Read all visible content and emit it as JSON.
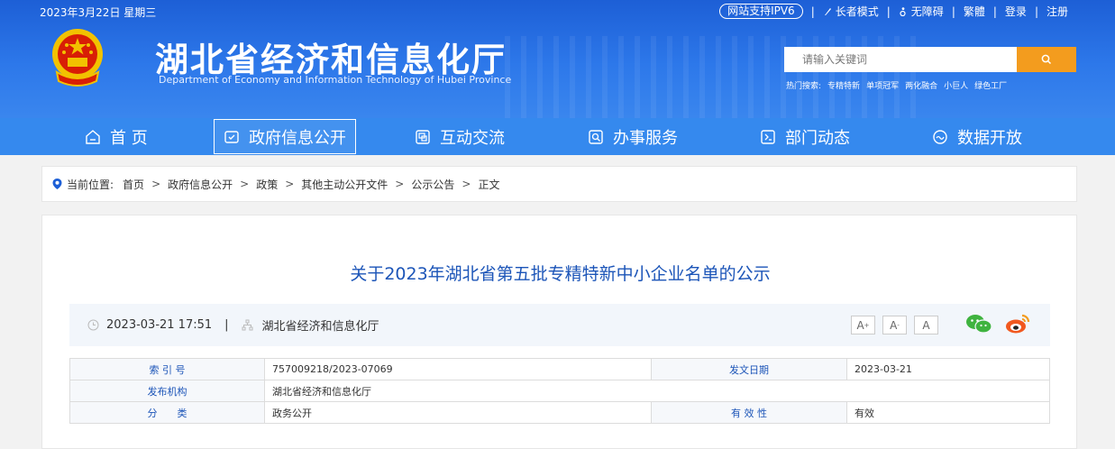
{
  "topbar": {
    "date": "2023年3月22日 星期三",
    "ipv6": "网站支持IPV6",
    "elder_mode": "长者模式",
    "accessibility": "无障碍",
    "traditional": "繁體",
    "login": "登录",
    "register": "注册",
    "separator": "|"
  },
  "header": {
    "title": "湖北省经济和信息化厅",
    "subtitle": "Department of Economy and Information Technology of Hubei Province"
  },
  "search": {
    "placeholder": "请输入关键词",
    "hot_label": "热门搜索:",
    "hot_terms": [
      "专精特新",
      "单项冠军",
      "两化融合",
      "小巨人",
      "绿色工厂"
    ]
  },
  "nav": {
    "items": [
      {
        "label": "首 页",
        "icon": "home-icon"
      },
      {
        "label": "政府信息公开",
        "icon": "document-check-icon",
        "active": true
      },
      {
        "label": "互动交流",
        "icon": "chat-icon"
      },
      {
        "label": "办事服务",
        "icon": "service-icon"
      },
      {
        "label": "部门动态",
        "icon": "news-icon"
      },
      {
        "label": "数据开放",
        "icon": "data-icon"
      }
    ]
  },
  "breadcrumb": {
    "label": "当前位置:",
    "gt": ">",
    "items": [
      "首页",
      "政府信息公开",
      "政策",
      "其他主动公开文件",
      "公示公告",
      "正文"
    ]
  },
  "article": {
    "title": "关于2023年湖北省第五批专精特新中小企业名单的公示",
    "datetime": "2023-03-21 17:51",
    "separator": "|",
    "publisher": "湖北省经济和信息化厅",
    "font_buttons": [
      "A",
      "A",
      "A"
    ],
    "font_sup": [
      "+",
      "-",
      ""
    ]
  },
  "info_table": {
    "index_label": "索 引 号",
    "index_value": "757009218/2023-07069",
    "date_label": "发文日期",
    "date_value": "2023-03-21",
    "org_label": "发布机构",
    "org_value": "湖北省经济和信息化厅",
    "category_label": "分　　类",
    "category_value": "政务公开",
    "validity_label": "有 效 性",
    "validity_value": "有效"
  },
  "colors": {
    "primary_blue": "#2d78ea",
    "nav_blue": "#3589ee",
    "search_orange": "#f39c1e",
    "title_blue": "#1c55b8"
  }
}
